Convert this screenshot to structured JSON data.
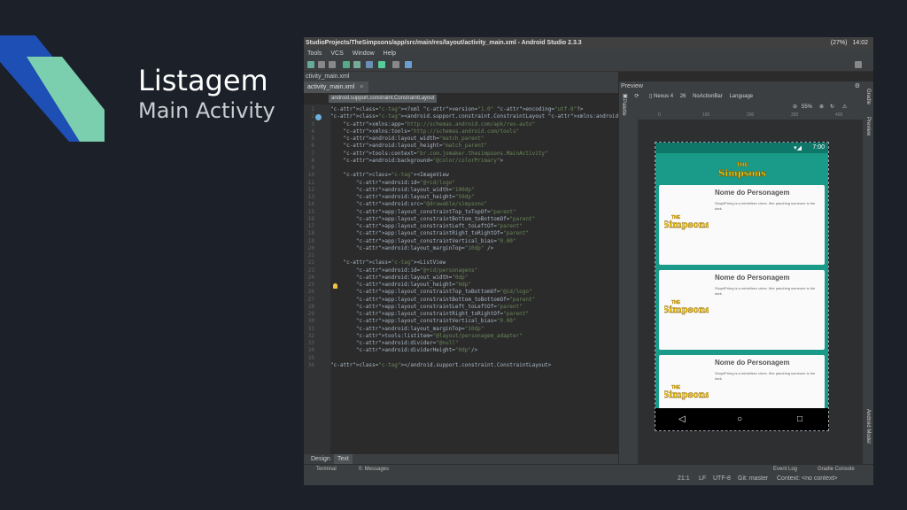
{
  "slide": {
    "title": "Listagem",
    "subtitle": "Main Activity",
    "colors": {
      "bg": "#1b2029",
      "stripe_blue": "#1e4fb4",
      "stripe_green": "#7ccfae"
    }
  },
  "window": {
    "title": "StudioProjects/TheSimpsons/app/src/main/res/layout/activity_main.xml - Android Studio 2.3.3",
    "battery": "(27%)",
    "time": "14:02"
  },
  "menu": [
    "Tools",
    "VCS",
    "Window",
    "Help"
  ],
  "nav_path": "ctivity_main.xml",
  "editor_tab": "activity_main.xml",
  "breadcrumb": "android.support.constraint.ConstraintLayout",
  "code_lines": [
    {
      "n": "1",
      "text": "<?xml version=\"1.0\" encoding=\"utf-8\"?>"
    },
    {
      "n": "2",
      "text": "<android.support.constraint.ConstraintLayout xmlns:android=\"http://schemas.android.com/"
    },
    {
      "n": "3",
      "text": "    xmlns:app=\"http://schemas.android.com/apk/res-auto\""
    },
    {
      "n": "4",
      "text": "    xmlns:tools=\"http://schemas.android.com/tools\""
    },
    {
      "n": "5",
      "text": "    android:layout_width=\"match_parent\""
    },
    {
      "n": "6",
      "text": "    android:layout_height=\"match_parent\""
    },
    {
      "n": "7",
      "text": "    tools:context=\"br.com.jomaker.thesimpsons.MainActivity\""
    },
    {
      "n": "8",
      "text": "    android:background=\"@color/colorPrimary\">"
    },
    {
      "n": "9",
      "text": ""
    },
    {
      "n": "10",
      "text": "    <ImageView"
    },
    {
      "n": "11",
      "text": "        android:id=\"@+id/logo\""
    },
    {
      "n": "12",
      "text": "        android:layout_width=\"100dp\""
    },
    {
      "n": "13",
      "text": "        android:layout_height=\"50dp\""
    },
    {
      "n": "14",
      "text": "        android:src=\"@drawable/simpsons\""
    },
    {
      "n": "15",
      "text": "        app:layout_constraintTop_toTopOf=\"parent\""
    },
    {
      "n": "16",
      "text": "        app:layout_constraintBottom_toBottomOf=\"parent\""
    },
    {
      "n": "17",
      "text": "        app:layout_constraintLeft_toLeftOf=\"parent\""
    },
    {
      "n": "18",
      "text": "        app:layout_constraintRight_toRightOf=\"parent\""
    },
    {
      "n": "19",
      "text": "        app:layout_constraintVertical_bias=\"0.00\""
    },
    {
      "n": "20",
      "text": "        android:layout_marginTop=\"10dp\" />"
    },
    {
      "n": "21",
      "text": ""
    },
    {
      "n": "22",
      "text": "    <ListView"
    },
    {
      "n": "23",
      "text": "        android:id=\"@+id/personagens\""
    },
    {
      "n": "24",
      "text": "        android:layout_width=\"0dp\""
    },
    {
      "n": "25",
      "text": "        android:layout_height=\"0dp\""
    },
    {
      "n": "26",
      "text": "        app:layout_constraintTop_toBottomOf=\"@id/logo\""
    },
    {
      "n": "27",
      "text": "        app:layout_constraintBottom_toBottomOf=\"parent\""
    },
    {
      "n": "28",
      "text": "        app:layout_constraintLeft_toLeftOf=\"parent\""
    },
    {
      "n": "29",
      "text": "        app:layout_constraintRight_toRightOf=\"parent\""
    },
    {
      "n": "30",
      "text": "        app:layout_constraintVertical_bias=\"0.00\""
    },
    {
      "n": "31",
      "text": "        android:layout_marginTop=\"10dp\""
    },
    {
      "n": "32",
      "text": "        tools:listitem=\"@layout/personagem_adapter\""
    },
    {
      "n": "33",
      "text": "        android:divider=\"@null\""
    },
    {
      "n": "34",
      "text": "        android:dividerHeight=\"0dp\"/>"
    },
    {
      "n": "35",
      "text": ""
    },
    {
      "n": "36",
      "text": "</android.support.constraint.ConstraintLayout>"
    }
  ],
  "bottom_tabs": [
    "Design",
    "Text"
  ],
  "tool_windows": {
    "terminal": "Terminal",
    "messages": "0: Messages",
    "event_log": "Event Log",
    "gradle_console": "Gradle Console"
  },
  "status": {
    "position": "21:1",
    "line_sep": "LF",
    "encoding": "UTF-8",
    "git": "Git: master",
    "context": "Context: <no context>"
  },
  "preview": {
    "title": "Preview",
    "device": "Nexus 4",
    "api": "26",
    "theme": "NoActionBar",
    "language": "Language",
    "zoom": "55%",
    "ruler": [
      "0",
      "100",
      "200",
      "300",
      "400"
    ]
  },
  "phone": {
    "time": "7:00",
    "logo_text": "THE Simpsons",
    "cards": [
      {
        "name": "Nome do Personagem",
        "desc": "ShopliPrimg is a mintellsex crime. Ithe panching someone is the dark."
      },
      {
        "name": "Nome do Personagem",
        "desc": "ShopliPrimg is a mintellsex crime. Ithe panching someone is the dark."
      },
      {
        "name": "Nome do Personagem",
        "desc": "ShopliPrimg is a mintellsex crime. Ithe panching someone is the dark."
      }
    ],
    "thumb_text": "THE Simpsons"
  },
  "side_panel": [
    "Gradle",
    "Preview",
    "Android Model"
  ],
  "left_panel": [
    "Palette"
  ]
}
